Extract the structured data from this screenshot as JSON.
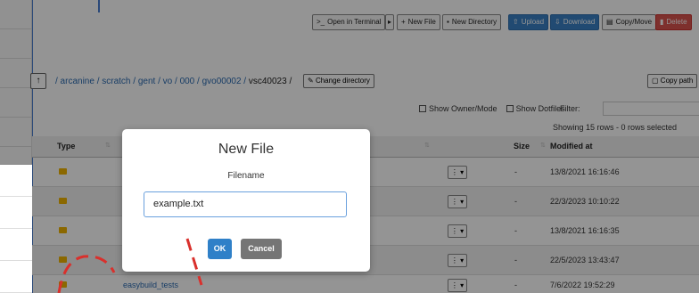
{
  "toolbar": {
    "terminal_label": "Open in Terminal",
    "new_file_label": "New File",
    "new_dir_label": "New Directory",
    "upload_label": "Upload",
    "download_label": "Download",
    "copy_move_label": "Copy/Move",
    "delete_label": "Delete"
  },
  "pathbar": {
    "up_glyph": "↑",
    "segments": [
      "/ arcanine /",
      "scratch /",
      "gent /",
      "vo /",
      "000 /",
      "gvo00002 /"
    ],
    "current": "vsc40023 /",
    "change_dir_label": "Change directory",
    "copy_path_label": "Copy path"
  },
  "options": {
    "show_owner_label": "Show Owner/Mode",
    "show_dotfiles_label": "Show Dotfiles",
    "filter_label": "Filter:",
    "showing_text": "Showing 15 rows - 0 rows selected"
  },
  "table": {
    "headers": {
      "type": "Type",
      "size": "Size",
      "modified": "Modified at"
    },
    "rows": [
      {
        "name": "",
        "size": "-",
        "modified": "13/8/2021 16:16:46"
      },
      {
        "name": "",
        "size": "-",
        "modified": "22/3/2023 10:10:22"
      },
      {
        "name": "",
        "size": "-",
        "modified": "13/8/2021 16:16:35"
      },
      {
        "name": "",
        "size": "-",
        "modified": "22/5/2023 13:43:47"
      },
      {
        "name": "easybuild_tests",
        "size": "-",
        "modified": "7/6/2022 19:52:29"
      }
    ],
    "row_menu_glyph": "⋮ ▾"
  },
  "modal": {
    "title": "New File",
    "label": "Filename",
    "input_value": "example.txt",
    "ok_label": "OK",
    "cancel_label": "Cancel"
  },
  "colors": {
    "primary": "#2f80c8",
    "danger": "#d9534f",
    "folder": "#f0b400",
    "annotation": "#d9302c"
  }
}
